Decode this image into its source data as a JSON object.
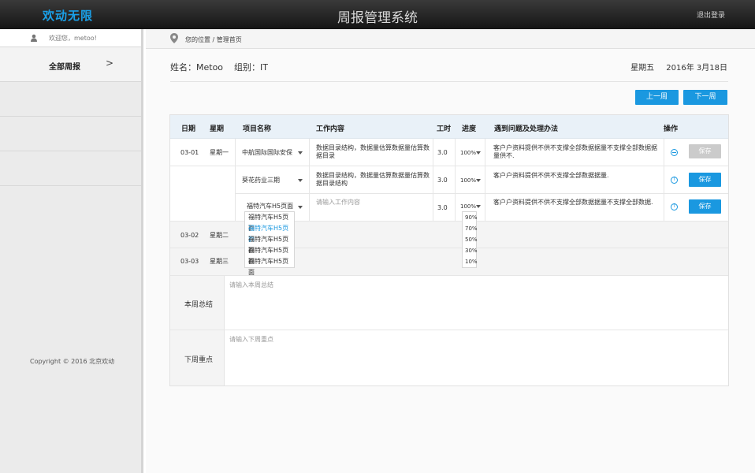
{
  "header": {
    "logo": "欢动无限",
    "title": "周报管理系统",
    "logout": "退出登录"
  },
  "sidebar": {
    "welcome": "欢迎您，metoo!",
    "items": [
      {
        "label": "全部周报",
        "chevron": ">"
      }
    ],
    "copyright": "Copyright © 2016 北京欢动"
  },
  "breadcrumb": {
    "text": "您的位置 / 管理首页"
  },
  "info": {
    "name": "姓名：Metoo",
    "group": "组别：IT",
    "weekday": "星期五",
    "date": "2016年 3月18日"
  },
  "nav": {
    "prev": "上一周",
    "next": "下一周"
  },
  "table": {
    "headers": [
      "日期",
      "星期",
      "项目名称",
      "工作内容",
      "工时",
      "进度",
      "遇到问题及处理办法",
      "操作"
    ],
    "rows": [
      {
        "date": "03-01",
        "day": "星期一",
        "project": "中航国际国际安保",
        "work": "数据目录结构，数据量估算数据量估算数据目录",
        "hours": "3.0",
        "progress": "100%",
        "issue": "客户户资料提供不供不支撑全部数据据量不支撑全部数据据量供不.",
        "save": "保存"
      },
      {
        "date": "",
        "day": "",
        "project": "葵花药业三期",
        "work": "数据目录结构，数据量估算数据量估算数据目录结构",
        "hours": "3.0",
        "progress": "100%",
        "issue": "客户户资料提供不供不支撑全部数据据量.",
        "save": "保存"
      },
      {
        "date": "",
        "day": "",
        "project": "福特汽车H5页面",
        "work_placeholder": "请输入工作内容",
        "hours": "3.0",
        "progress": "100%",
        "issue": "客户户资料提供不供不支撑全部数据据量不支撑全部数据.",
        "save": "保存"
      },
      {
        "date": "03-02",
        "day": "星期二"
      },
      {
        "date": "03-03",
        "day": "星期三"
      }
    ],
    "project_dropdown": [
      "福特汽车H5页面",
      "福特汽车H5页面",
      "福特汽车H5页面",
      "福特汽车H5页面",
      "福特汽车H5页面"
    ],
    "progress_dropdown": [
      "90%",
      "70%",
      "50%",
      "30%",
      "10%"
    ]
  },
  "summary": {
    "week_label": "本周总结",
    "week_placeholder": "请输入本周总结",
    "next_label": "下周重点",
    "next_placeholder": "请输入下周重点"
  }
}
